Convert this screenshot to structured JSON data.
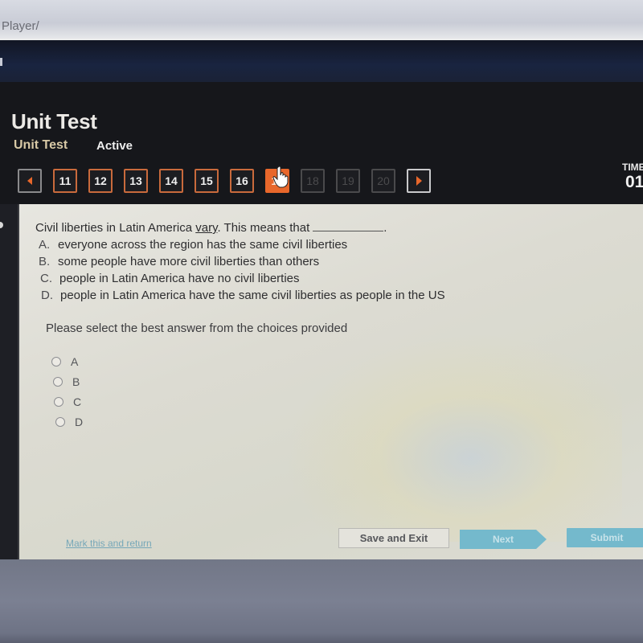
{
  "browser": {
    "url_fragment": "Player/"
  },
  "header": {
    "title": "Unit Test",
    "subtitle": "Unit Test",
    "status": "Active",
    "timer_label": "TIME",
    "timer_value": "01"
  },
  "question_nav": {
    "prev_icon": "triangle-left-icon",
    "next_icon": "triangle-right-icon",
    "items": [
      {
        "label": "11",
        "state": "answered"
      },
      {
        "label": "12",
        "state": "answered"
      },
      {
        "label": "13",
        "state": "answered"
      },
      {
        "label": "14",
        "state": "answered"
      },
      {
        "label": "15",
        "state": "answered"
      },
      {
        "label": "16",
        "state": "answered"
      },
      {
        "label": "17",
        "state": "current"
      },
      {
        "label": "18",
        "state": "locked"
      },
      {
        "label": "19",
        "state": "locked"
      },
      {
        "label": "20",
        "state": "locked"
      }
    ],
    "accent_color": "#e8672b"
  },
  "question": {
    "stem_before": "Civil liberties in Latin America ",
    "stem_keyword": "vary",
    "stem_after": ". This means that",
    "stem_end": ".",
    "choices": [
      {
        "letter": "A.",
        "text": "everyone across the region has the same civil liberties"
      },
      {
        "letter": "B.",
        "text": "some people have more civil liberties than others"
      },
      {
        "letter": "C.",
        "text": "people in Latin America have no civil liberties"
      },
      {
        "letter": "D.",
        "text": "people in Latin America have the same civil liberties as people in the US"
      }
    ],
    "prompt": "Please select the best answer from the choices provided",
    "options": [
      "A",
      "B",
      "C",
      "D"
    ],
    "selected": null
  },
  "footer": {
    "mark_link": "Mark this and return",
    "save_exit": "Save and Exit",
    "next": "Next",
    "submit": "Submit",
    "button_color": "#74b9cc"
  }
}
